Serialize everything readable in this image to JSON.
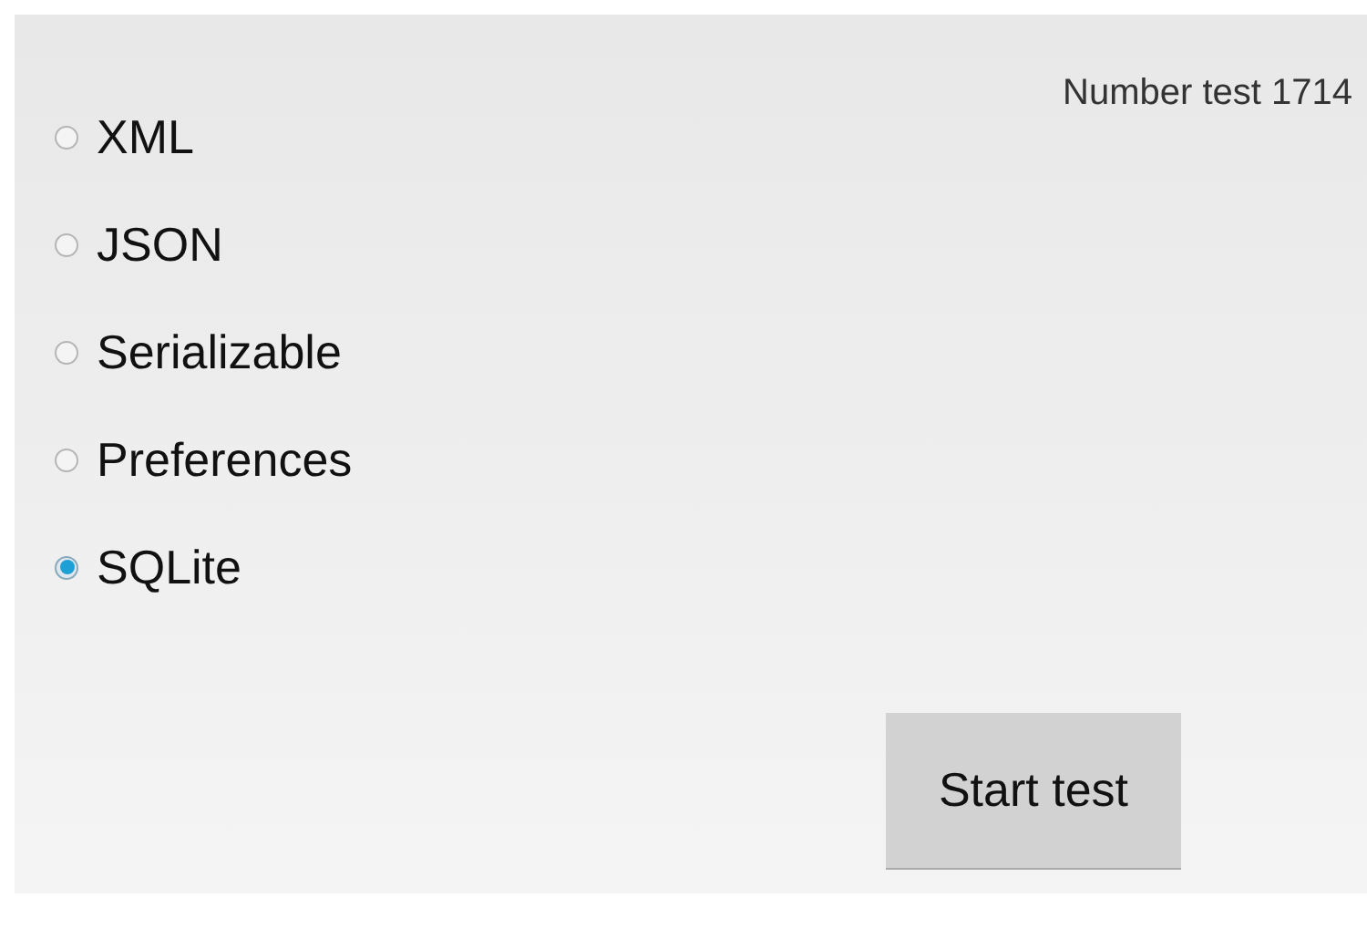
{
  "options": [
    {
      "label": "XML",
      "selected": false
    },
    {
      "label": "JSON",
      "selected": false
    },
    {
      "label": "Serializable",
      "selected": false
    },
    {
      "label": "Preferences",
      "selected": false
    },
    {
      "label": "SQLite",
      "selected": true
    }
  ],
  "counter": "Number test 1714",
  "button": "Start test"
}
